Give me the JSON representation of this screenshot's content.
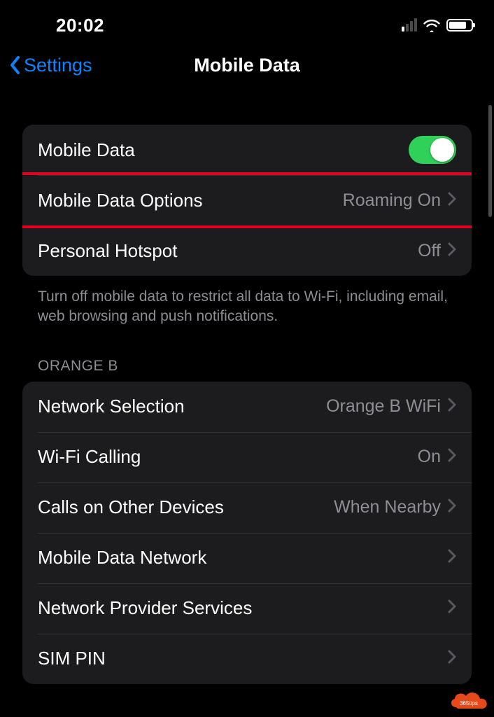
{
  "status": {
    "time": "20:02"
  },
  "nav": {
    "back_label": "Settings",
    "title": "Mobile Data"
  },
  "group1": {
    "mobile_data_label": "Mobile Data",
    "mobile_data_options_label": "Mobile Data Options",
    "mobile_data_options_value": "Roaming On",
    "personal_hotspot_label": "Personal Hotspot",
    "personal_hotspot_value": "Off",
    "footer": "Turn off mobile data to restrict all data to Wi-Fi, including email, web browsing and push notifications."
  },
  "group2": {
    "header": "ORANGE B",
    "network_selection_label": "Network Selection",
    "network_selection_value": "Orange B WiFi",
    "wifi_calling_label": "Wi-Fi Calling",
    "wifi_calling_value": "On",
    "calls_other_label": "Calls on Other Devices",
    "calls_other_value": "When Nearby",
    "mobile_data_network_label": "Mobile Data Network",
    "provider_services_label": "Network Provider Services",
    "sim_pin_label": "SIM PIN"
  },
  "watermark": {
    "text": "365tips"
  }
}
